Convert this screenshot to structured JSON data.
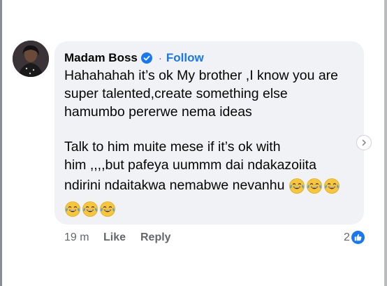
{
  "comment": {
    "author": "Madam Boss",
    "separator": "·",
    "follow_label": "Follow",
    "lines": [
      "Hahahahah it’s ok My brother ,I know you are",
      "super talented,create something else",
      "hamumbo pererwe nema ideas",
      "Talk to him muite mese if it’s ok with",
      "him ,,,,but pafeya uummm dai ndakazoiita",
      "ndirini ndaitakwa nemabwe nevanhu"
    ],
    "emoji_name": "face-with-tears-of-joy",
    "timestamp": "19 m",
    "like_label": "Like",
    "reply_label": "Reply",
    "reaction_count": "2"
  },
  "colors": {
    "bubble": "#f0f2f5",
    "link": "#1877f2",
    "meta": "#65676b",
    "text": "#050505"
  }
}
